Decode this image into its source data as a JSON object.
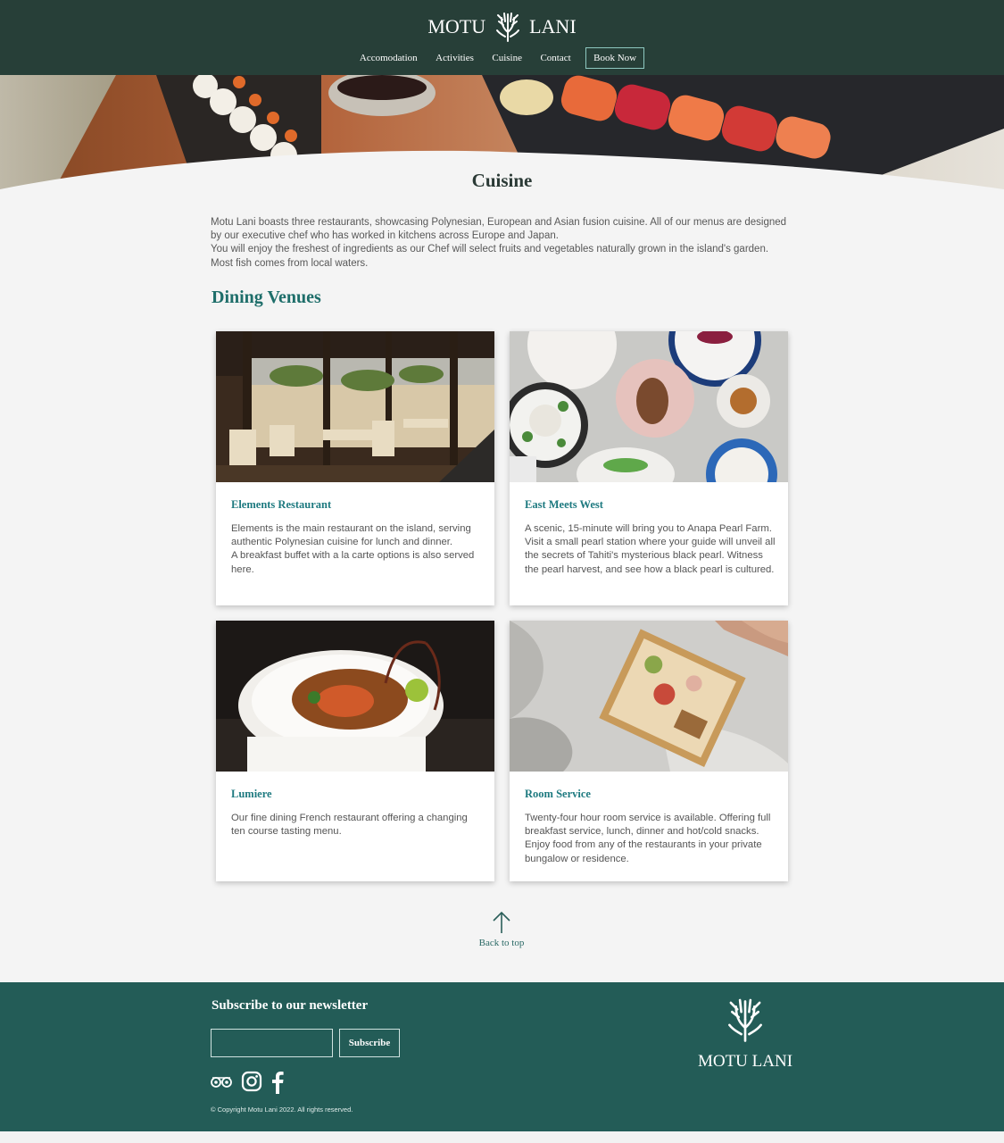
{
  "brand": {
    "name_left": "MOTU",
    "name_right": "LANI"
  },
  "nav": {
    "items": [
      "Accomodation",
      "Activities",
      "Cuisine",
      "Contact"
    ],
    "book_label": "Book Now"
  },
  "page": {
    "title": "Cuisine",
    "intro": [
      "Motu Lani boasts three restaurants, showcasing Polynesian, European and Asian fusion cuisine. All of our menus are designed by our executive chef who has worked in kitchens across Europe and Japan.",
      "You will enjoy the freshest of ingredients as our Chef will select fruits and vegetables naturally grown in the island's garden. Most fish comes from local waters."
    ],
    "section_title": "Dining Venues"
  },
  "venues": [
    {
      "title": "Elements Restaurant",
      "description": "Elements is the main restaurant on the island, serving authentic Polynesian cuisine for lunch and dinner.\nA breakfast buffet with a la carte options is also served here."
    },
    {
      "title": "East Meets West",
      "description": "A scenic, 15-minute will bring you to Anapa Pearl Farm. Visit a small pearl station where your guide will unveil all the secrets of Tahiti's mysterious black pearl. Witness the pearl harvest, and see how a black pearl is cultured."
    },
    {
      "title": "Lumiere",
      "description": "Our fine dining French restaurant offering a changing ten course tasting menu."
    },
    {
      "title": "Room Service",
      "description": "Twenty-four hour room service is available. Offering full breakfast service, lunch, dinner and hot/cold snacks. Enjoy food from any of the restaurants in your private bungalow or residence."
    }
  ],
  "back_to_top": "Back to top",
  "footer": {
    "newsletter_title": "Subscribe to our newsletter",
    "newsletter_placeholder": "",
    "subscribe_label": "Subscribe",
    "social_icons": [
      "tripadvisor-icon",
      "instagram-icon",
      "facebook-icon"
    ],
    "copyright": "© Copyright Motu Lani 2022. All rights reserved.",
    "logo_text": "MOTU LANI"
  },
  "colors": {
    "header_bg": "#273f38",
    "footer_bg": "#235c57",
    "accent": "#1e6e6a",
    "card_title": "#1e7a80"
  }
}
